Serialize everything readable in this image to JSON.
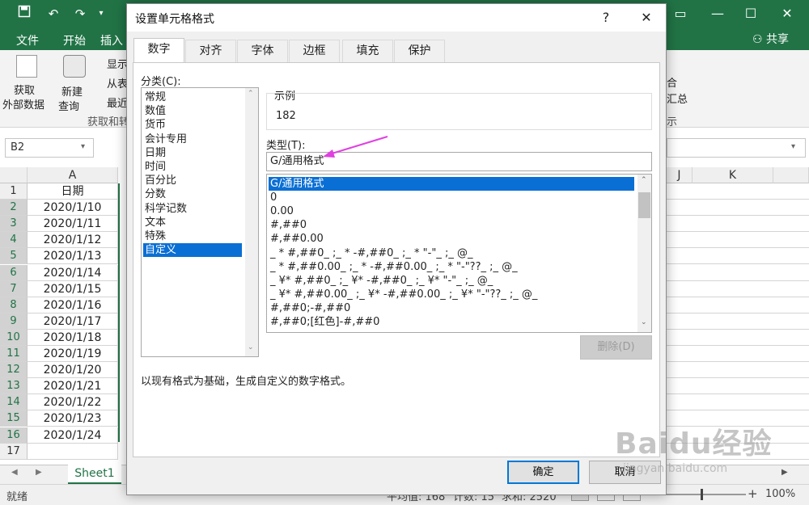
{
  "excel": {
    "ribbon_tabs": [
      "文件",
      "开始",
      "插入"
    ],
    "share_label": "共享",
    "ribbon": {
      "get_external_data": "获取\n外部数据",
      "get_external_data_l1": "获取",
      "get_external_data_l2": "外部数据",
      "new_query_l1": "新建",
      "new_query_l2": "查询",
      "show": "显示",
      "from_table": "从表",
      "recent": "最近",
      "group_label": "获取和转",
      "right_frag1": "合",
      "right_frag2": "汇总",
      "right_frag3": "示"
    },
    "name_box": "B2",
    "columns": [
      "A",
      "J",
      "K"
    ],
    "rows": [
      {
        "num": "1",
        "value": "日期"
      },
      {
        "num": "2",
        "value": "2020/1/10"
      },
      {
        "num": "3",
        "value": "2020/1/11"
      },
      {
        "num": "4",
        "value": "2020/1/12"
      },
      {
        "num": "5",
        "value": "2020/1/13"
      },
      {
        "num": "6",
        "value": "2020/1/14"
      },
      {
        "num": "7",
        "value": "2020/1/15"
      },
      {
        "num": "8",
        "value": "2020/1/16"
      },
      {
        "num": "9",
        "value": "2020/1/17"
      },
      {
        "num": "10",
        "value": "2020/1/18"
      },
      {
        "num": "11",
        "value": "2020/1/19"
      },
      {
        "num": "12",
        "value": "2020/1/20"
      },
      {
        "num": "13",
        "value": "2020/1/21"
      },
      {
        "num": "14",
        "value": "2020/1/22"
      },
      {
        "num": "15",
        "value": "2020/1/23"
      },
      {
        "num": "16",
        "value": "2020/1/24"
      },
      {
        "num": "17",
        "value": ""
      }
    ],
    "sheet_tab": "Sheet1",
    "status": {
      "ready": "就绪",
      "avg": "平均值: 168",
      "count": "计数: 15",
      "sum": "求和: 2520",
      "zoom": "100%"
    }
  },
  "dialog": {
    "title": "设置单元格格式",
    "help": "?",
    "close": "✕",
    "tabs": [
      "数字",
      "对齐",
      "字体",
      "边框",
      "填充",
      "保护"
    ],
    "category_label": "分类(C):",
    "categories": [
      "常规",
      "数值",
      "货币",
      "会计专用",
      "日期",
      "时间",
      "百分比",
      "分数",
      "科学记数",
      "文本",
      "特殊",
      "自定义"
    ],
    "selected_category": "自定义",
    "sample_label": "示例",
    "sample_value": "182",
    "type_label": "类型(T):",
    "type_value": "G/通用格式",
    "formats": [
      "G/通用格式",
      "0",
      "0.00",
      "#,##0",
      "#,##0.00",
      "_ * #,##0_ ;_ * -#,##0_ ;_ * \"-\"_ ;_ @_",
      "_ * #,##0.00_ ;_ * -#,##0.00_ ;_ * \"-\"??_ ;_ @_",
      "_ ¥* #,##0_ ;_ ¥* -#,##0_ ;_ ¥* \"-\"_ ;_ @_",
      "_ ¥* #,##0.00_ ;_ ¥* -#,##0.00_ ;_ ¥* \"-\"??_ ;_ @_",
      "#,##0;-#,##0",
      "#,##0;[红色]-#,##0"
    ],
    "delete_label": "删除(D)",
    "description": "以现有格式为基础，生成自定义的数字格式。",
    "ok_label": "确定",
    "cancel_label": "取消"
  },
  "watermark": {
    "brand": "Baidu经验",
    "url": "jingyan.baidu.com"
  },
  "colors": {
    "excel_green": "#217346",
    "selection_blue": "#0a6fd4",
    "arrow_magenta": "#e040e0"
  }
}
